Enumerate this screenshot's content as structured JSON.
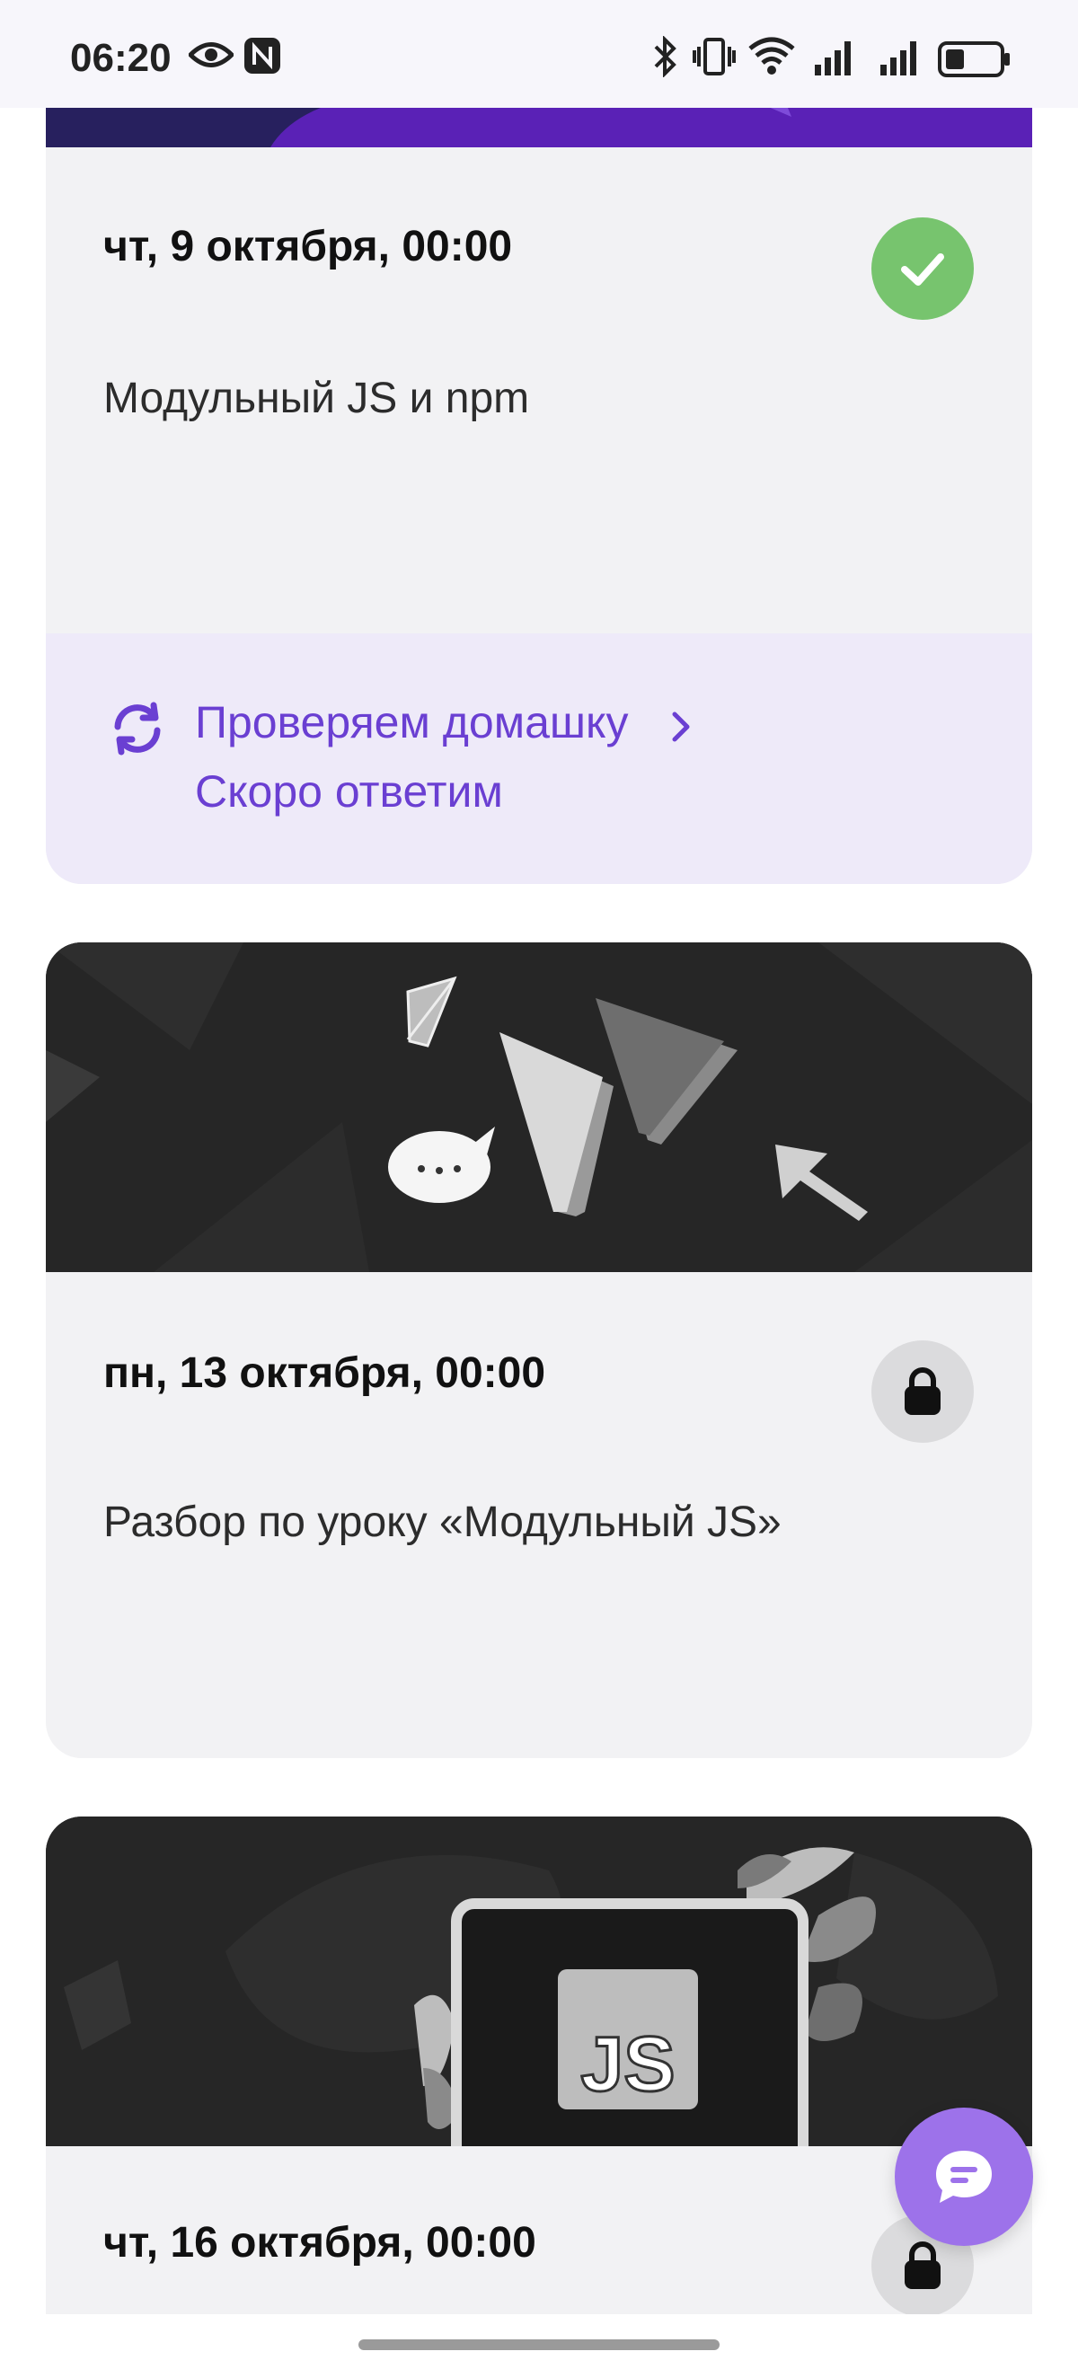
{
  "status_bar": {
    "time": "06:20",
    "icons": [
      "eye-icon",
      "nfc-icon",
      "bluetooth-icon",
      "vibrate-icon",
      "wifi-icon",
      "signal-icon",
      "signal-icon",
      "battery-icon"
    ]
  },
  "lessons": [
    {
      "date": "чт, 9 октября, 00:00",
      "title": "Модульный JS и npm",
      "status": "done",
      "homework": {
        "line1": "Проверяем домашку",
        "line2": "Скоро ответим",
        "icon": "refresh-icon"
      }
    },
    {
      "date": "пн, 13 октября, 00:00",
      "title": "Разбор по уроку «Модульный JS»",
      "status": "locked"
    },
    {
      "date": "чт, 16 октября, 00:00",
      "banner_text": "JS",
      "status": "locked"
    }
  ],
  "colors": {
    "accent": "#6a3fd2",
    "done": "#77c46e",
    "locked": "#dbdbdd",
    "card_bg": "#f2f2f4",
    "fab": "#9d72ea"
  }
}
